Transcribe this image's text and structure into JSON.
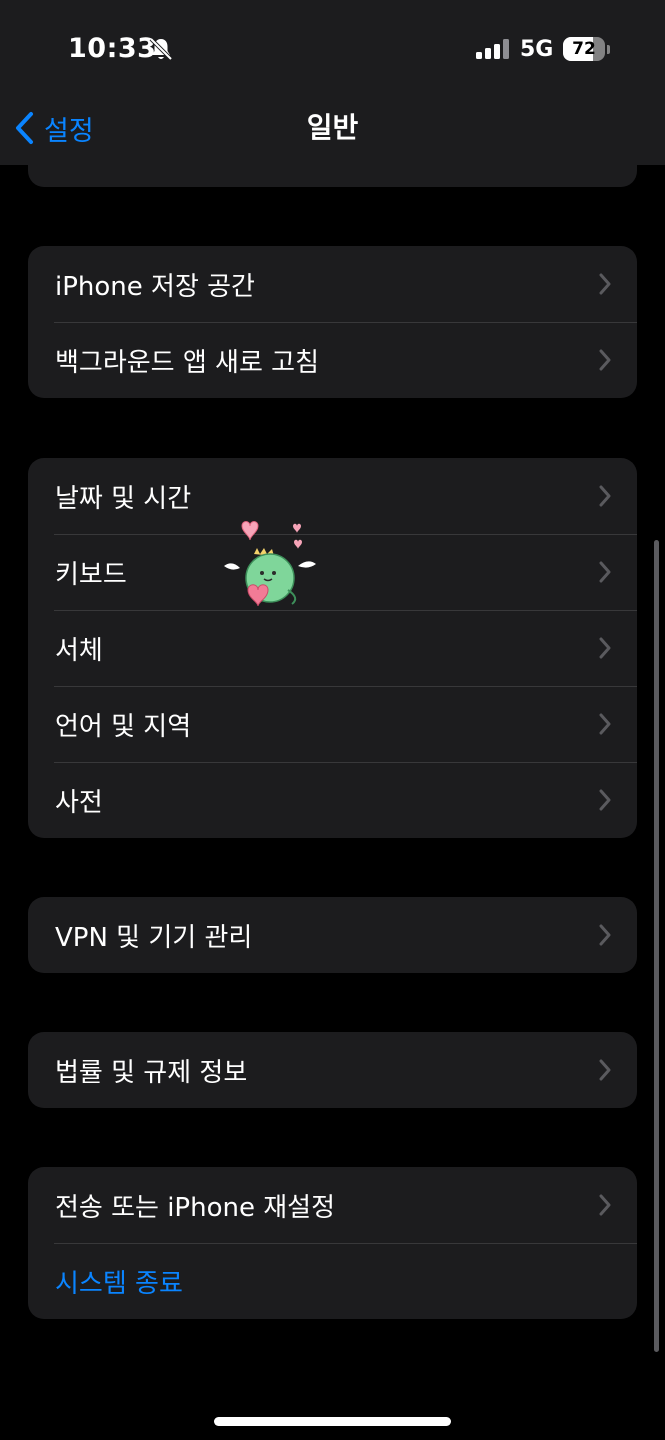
{
  "status_bar": {
    "time": "10:33",
    "network": "5G",
    "battery": "72",
    "battery_level": 0.72,
    "icons": [
      "bell-slash-icon",
      "signal-icon",
      "battery-icon"
    ]
  },
  "nav": {
    "back_label": "설정",
    "title": "일반"
  },
  "groups": [
    {
      "items": [
        "iPhone 저장 공간",
        "백그라운드 앱 새로 고침"
      ]
    },
    {
      "items": [
        "날짜 및 시간",
        "키보드",
        "서체",
        "언어 및 지역",
        "사전"
      ]
    },
    {
      "items": [
        "VPN 및 기기 관리"
      ]
    },
    {
      "items": [
        "법률 및 규제 정보"
      ]
    },
    {
      "items": [
        "전송 또는 iPhone 재설정"
      ],
      "action": "시스템 종료"
    }
  ],
  "colors": {
    "accent": "#0a84ff",
    "background": "#000000",
    "cell": "#1c1c1e",
    "separator": "#38383a",
    "chevron": "#5a5a5e"
  }
}
